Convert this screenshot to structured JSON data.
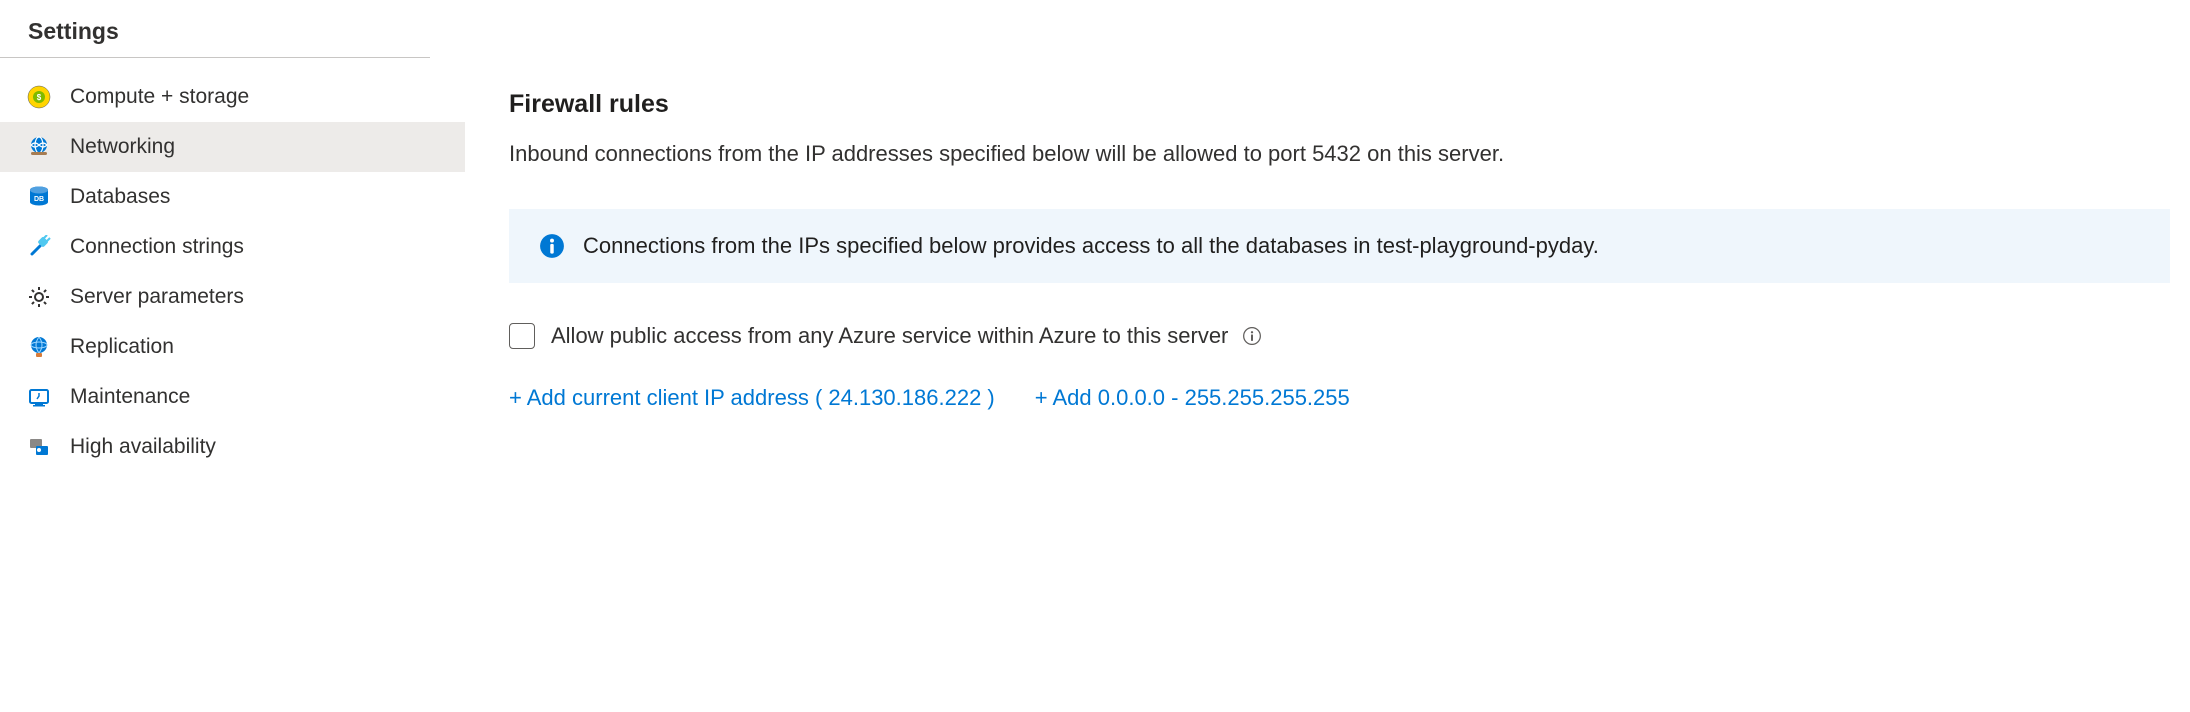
{
  "sidebar": {
    "header": "Settings",
    "items": [
      {
        "label": "Compute + storage"
      },
      {
        "label": "Networking"
      },
      {
        "label": "Databases"
      },
      {
        "label": "Connection strings"
      },
      {
        "label": "Server parameters"
      },
      {
        "label": "Replication"
      },
      {
        "label": "Maintenance"
      },
      {
        "label": "High availability"
      }
    ]
  },
  "main": {
    "title": "Firewall rules",
    "description": "Inbound connections from the IP addresses specified below will be allowed to port 5432 on this server.",
    "info_text": "Connections from the IPs specified below provides access to all the databases in test-playground-pyday.",
    "checkbox_label": "Allow public access from any Azure service within Azure to this server",
    "link_add_client": "+ Add current client IP address ( 24.130.186.222 ) ",
    "link_add_all": "+ Add 0.0.0.0 - 255.255.255.255"
  }
}
